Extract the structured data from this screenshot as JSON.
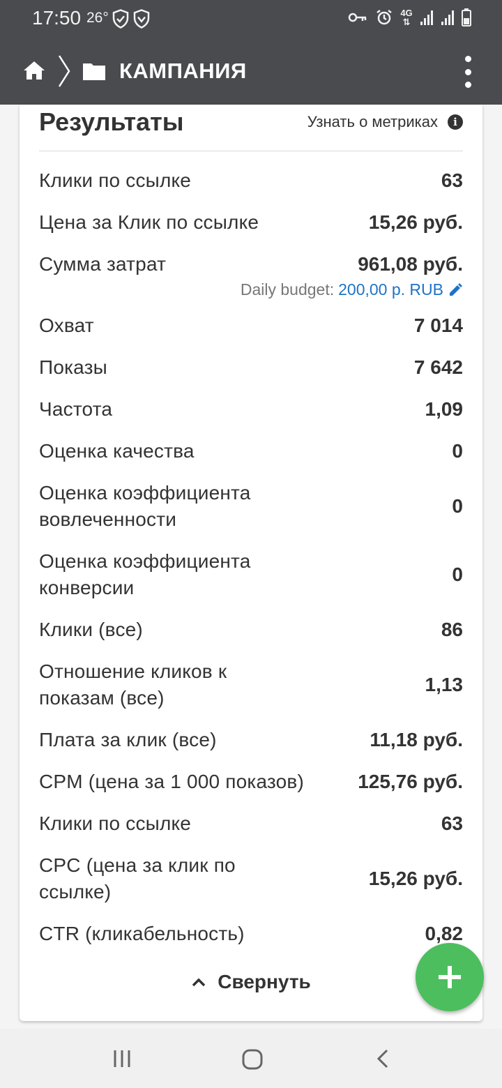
{
  "status_bar": {
    "time": "17:50",
    "temperature": "26°",
    "icons": [
      "shield-check-icon",
      "shield-icon",
      "key-icon",
      "alarm-icon",
      "network-4g-icon",
      "signal-icon",
      "signal-icon",
      "battery-icon"
    ],
    "network_label": "4G"
  },
  "app_bar": {
    "title": "КАМПАНИЯ",
    "icons": [
      "home-icon",
      "chevron-right-icon",
      "folder-icon",
      "more-vert-icon"
    ]
  },
  "results": {
    "title": "Результаты",
    "learn_link": "Узнать о метриках",
    "rows": [
      {
        "label": "Клики по ссылке",
        "value": "63"
      },
      {
        "label": "Цена за Клик по ссылке",
        "value": "15,26 руб."
      },
      {
        "label": "Сумма затрат",
        "value": "961,08 руб."
      },
      {
        "label": "Охват",
        "value": "7 014"
      },
      {
        "label": "Показы",
        "value": "7 642"
      },
      {
        "label": "Частота",
        "value": "1,09"
      },
      {
        "label": "Оценка качества",
        "value": "0"
      },
      {
        "label": "Оценка коэффициента вовлеченности",
        "value": "0"
      },
      {
        "label": "Оценка коэффициента конверсии",
        "value": "0"
      },
      {
        "label": "Клики (все)",
        "value": "86"
      },
      {
        "label": "Отношение кликов к показам (все)",
        "value": "1,13"
      },
      {
        "label": "Плата за клик (все)",
        "value": "11,18 руб."
      },
      {
        "label": "CPM (цена за 1 000 показов)",
        "value": "125,76 руб."
      },
      {
        "label": "Клики по ссылке",
        "value": "63"
      },
      {
        "label": "CPC (цена за клик по ссылке)",
        "value": "15,26 руб."
      },
      {
        "label": "CTR (кликабельность)",
        "value": "0,82"
      }
    ],
    "daily_budget_label": "Daily budget:",
    "daily_budget_value": "200,00 р. RUB",
    "collapse_label": "Свернуть"
  },
  "colors": {
    "header_bg": "#4a4b4f",
    "link_blue": "#1e73c6",
    "fab_green": "#4cbe5e",
    "text": "#333333"
  }
}
